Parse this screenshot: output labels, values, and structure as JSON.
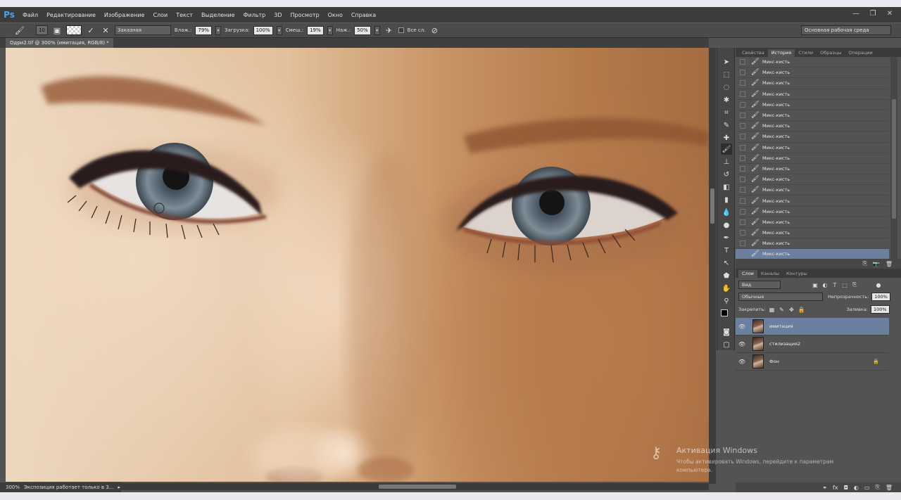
{
  "app": {
    "logo": "Ps",
    "title_tab": "Одри2.tif @ 300% (имитация, RGB/8) *"
  },
  "menu": [
    "Файл",
    "Редактирование",
    "Изображение",
    "Слои",
    "Текст",
    "Выделение",
    "Фильтр",
    "3D",
    "Просмотр",
    "Окно",
    "Справка"
  ],
  "window_controls": {
    "minimize": "—",
    "restore": "❐",
    "close": "✕"
  },
  "options": {
    "brush_size": "10",
    "preset": "Заказная",
    "wet_label": "Влаж.:",
    "wet_value": "79%",
    "load_label": "Загрузка:",
    "load_value": "100%",
    "mix_label": "Смеш.:",
    "mix_value": "19%",
    "flow_label": "Наж.:",
    "flow_value": "50%",
    "all_layers_label": "Все сл.",
    "workspace": "Основная рабочая среда"
  },
  "status": {
    "zoom": "300%",
    "text": "Экспозиция работает только в 3..."
  },
  "history_panel": {
    "tabs": [
      "Свойства",
      "История",
      "Стили",
      "Образцы",
      "Операции"
    ],
    "active_tab": "История",
    "items": [
      "Микс-кисть",
      "Микс-кисть",
      "Микс-кисть",
      "Микс-кисть",
      "Микс-кисть",
      "Микс-кисть",
      "Микс-кисть",
      "Микс-кисть",
      "Микс-кисть",
      "Микс-кисть",
      "Микс-кисть",
      "Микс-кисть",
      "Микс-кисть",
      "Микс-кисть",
      "Микс-кисть",
      "Микс-кисть",
      "Микс-кисть",
      "Микс-кисть",
      "Микс-кисть"
    ]
  },
  "layers_panel": {
    "tabs": [
      "Слои",
      "Каналы",
      "Контуры"
    ],
    "active_tab": "Слои",
    "filter": "Вид",
    "blend_mode": "Обычные",
    "opacity_label": "Непрозрачность:",
    "opacity_value": "100%",
    "lock_label": "Закрепить:",
    "fill_label": "Заливка:",
    "fill_value": "100%",
    "layers": [
      {
        "name": "имитация",
        "active": true,
        "locked": false
      },
      {
        "name": "стилизация2",
        "active": false,
        "locked": false
      },
      {
        "name": "Фон",
        "active": false,
        "locked": true
      }
    ]
  },
  "watermark": {
    "title": "Активация Windows",
    "text": "Чтобы активировать Windows, перейдите к параметрам компьютера."
  },
  "colors": {
    "selection": "#6b7f9e",
    "accent_logo": "#4ea3e8"
  }
}
